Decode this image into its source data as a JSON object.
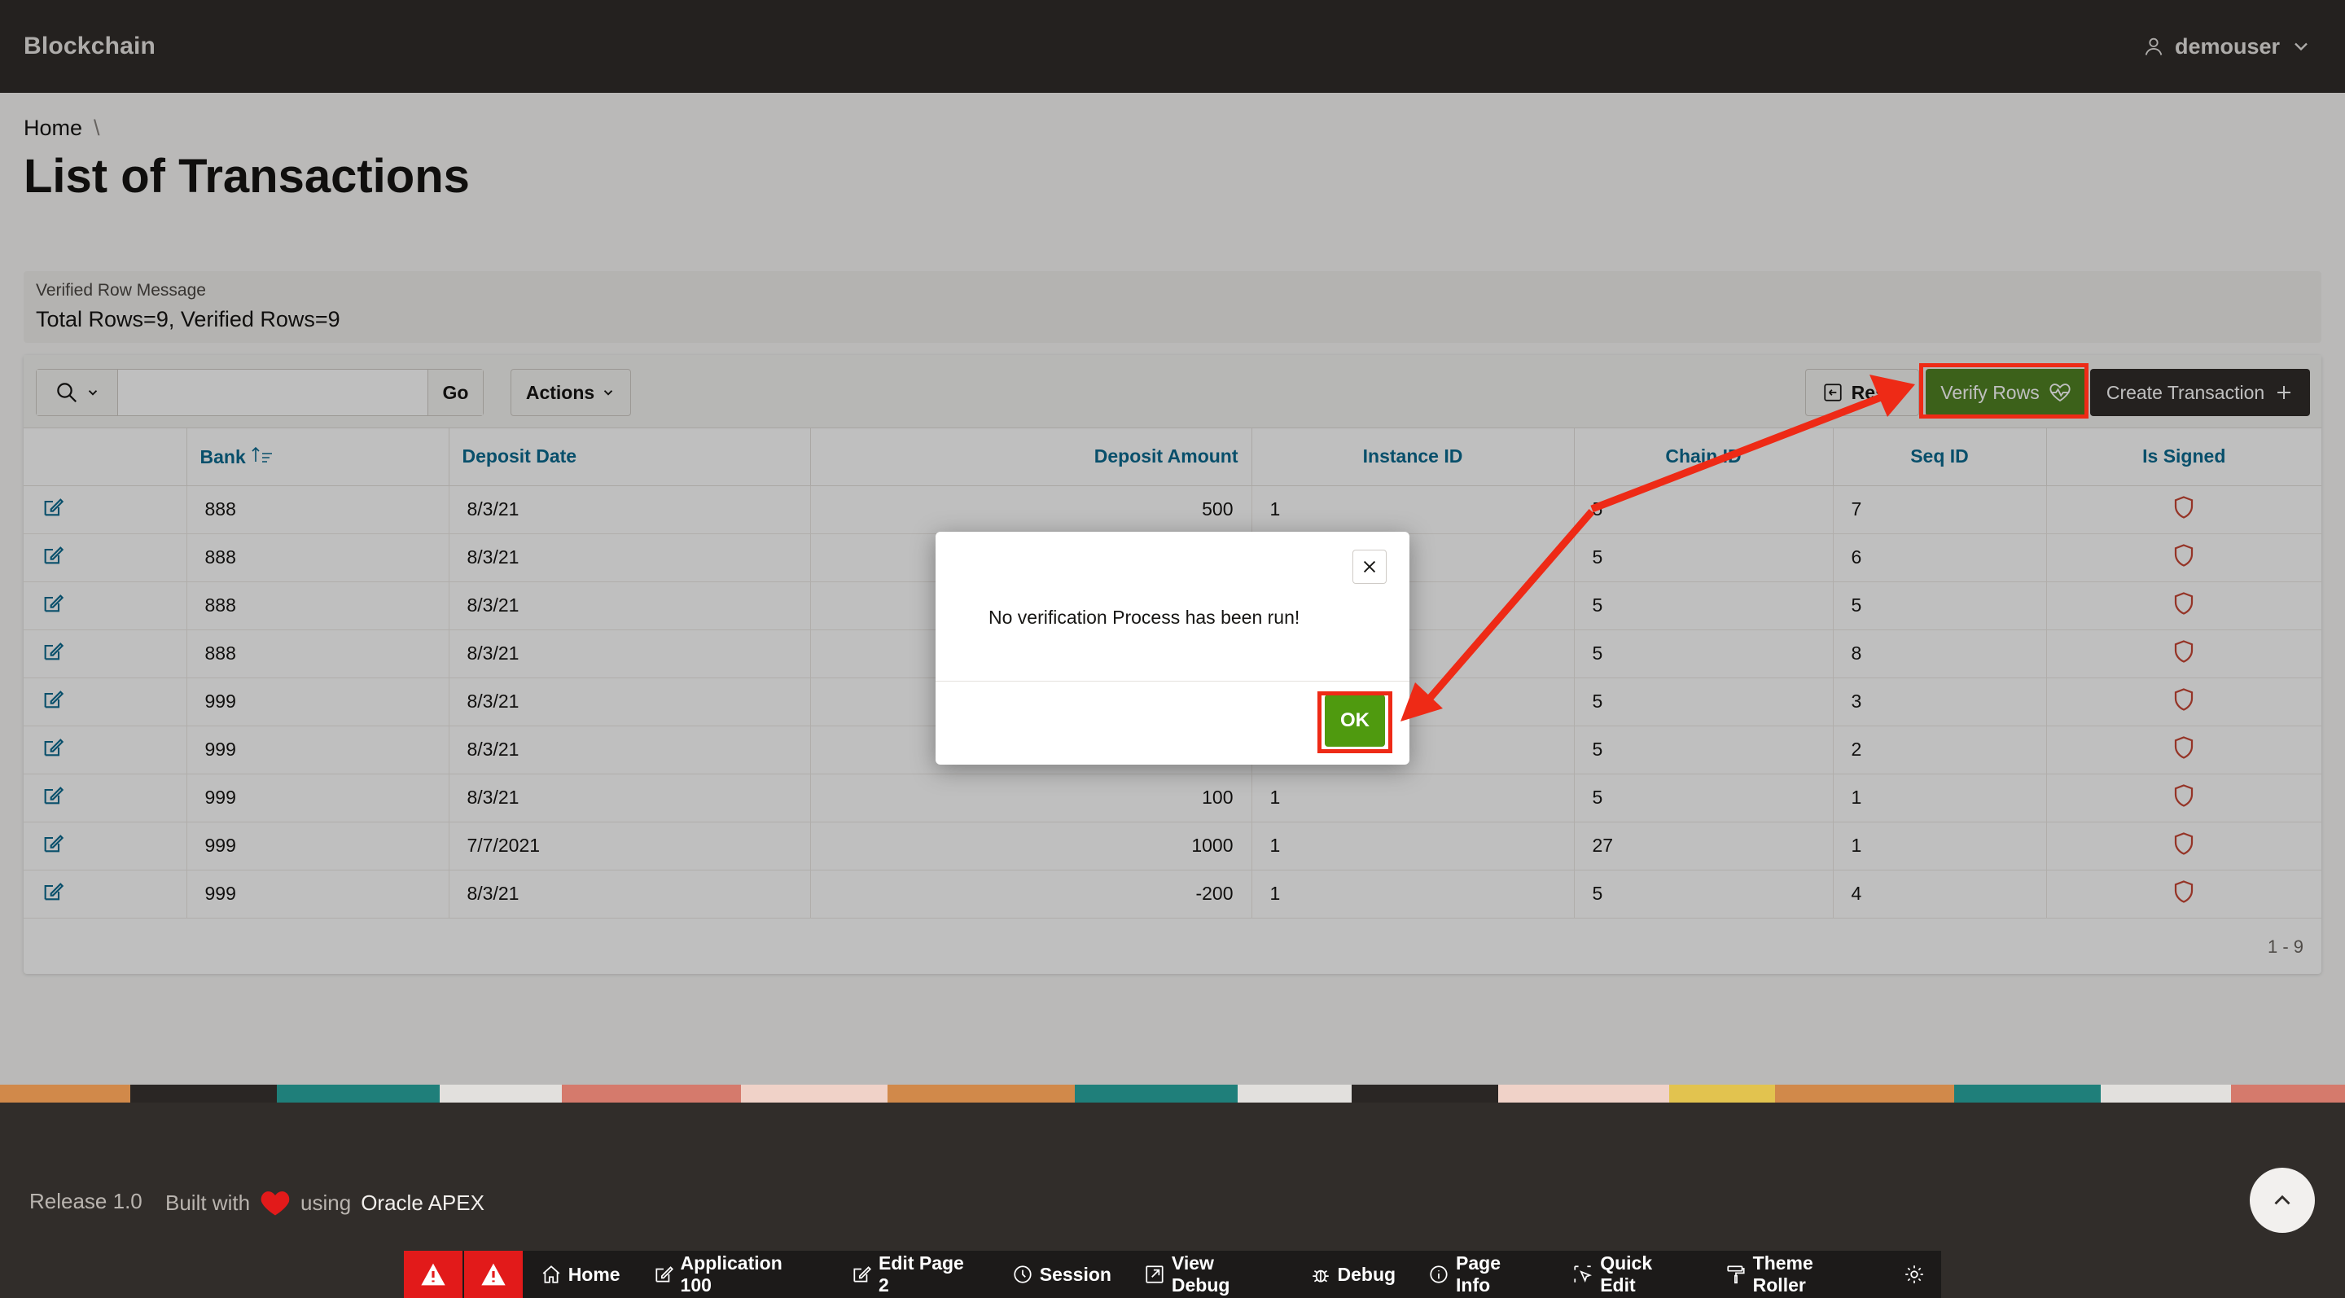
{
  "app": {
    "title": "Blockchain",
    "user": "demouser"
  },
  "breadcrumb": {
    "home": "Home",
    "separator": "\\"
  },
  "page": {
    "title": "List of Transactions"
  },
  "message_region": {
    "label": "Verified Row Message",
    "value": "Total Rows=9, Verified Rows=9"
  },
  "toolbar": {
    "go": "Go",
    "actions": "Actions",
    "reset": "Reset",
    "verify": "Verify Rows",
    "create": "Create Transaction"
  },
  "table": {
    "headers": [
      "",
      "Bank",
      "Deposit Date",
      "Deposit Amount",
      "Instance ID",
      "Chain ID",
      "Seq ID",
      "Is Signed"
    ],
    "rows": [
      [
        "888",
        "8/3/21",
        "500",
        "1",
        "5",
        "7"
      ],
      [
        "888",
        "8/3/21",
        "",
        "",
        "5",
        "6"
      ],
      [
        "888",
        "8/3/21",
        "",
        "",
        "5",
        "5"
      ],
      [
        "888",
        "8/3/21",
        "",
        "",
        "5",
        "8"
      ],
      [
        "999",
        "8/3/21",
        "",
        "",
        "5",
        "3"
      ],
      [
        "999",
        "8/3/21",
        "",
        "",
        "5",
        "2"
      ],
      [
        "999",
        "8/3/21",
        "100",
        "1",
        "5",
        "1"
      ],
      [
        "999",
        "7/7/2021",
        "1000",
        "1",
        "27",
        "1"
      ],
      [
        "999",
        "8/3/21",
        "-200",
        "1",
        "5",
        "4"
      ]
    ],
    "pagination": "1 - 9"
  },
  "dialog": {
    "message": "No verification Process has been run!",
    "ok": "OK"
  },
  "footer": {
    "release": "Release 1.0",
    "built_with": "Built with",
    "using": "using",
    "apex": "Oracle APEX"
  },
  "devbar": {
    "items": [
      "Home",
      "Application 100",
      "Edit Page 2",
      "Session",
      "View Debug",
      "Debug",
      "Page Info",
      "Quick Edit",
      "Theme Roller"
    ]
  },
  "colors": {
    "accent_green": "#508223",
    "ok_green": "#4f9a0f",
    "header_dark": "#312d2a",
    "link_blue": "#0b6a8f",
    "annotation_red": "#ee2a16",
    "signed_red": "#c74634"
  }
}
